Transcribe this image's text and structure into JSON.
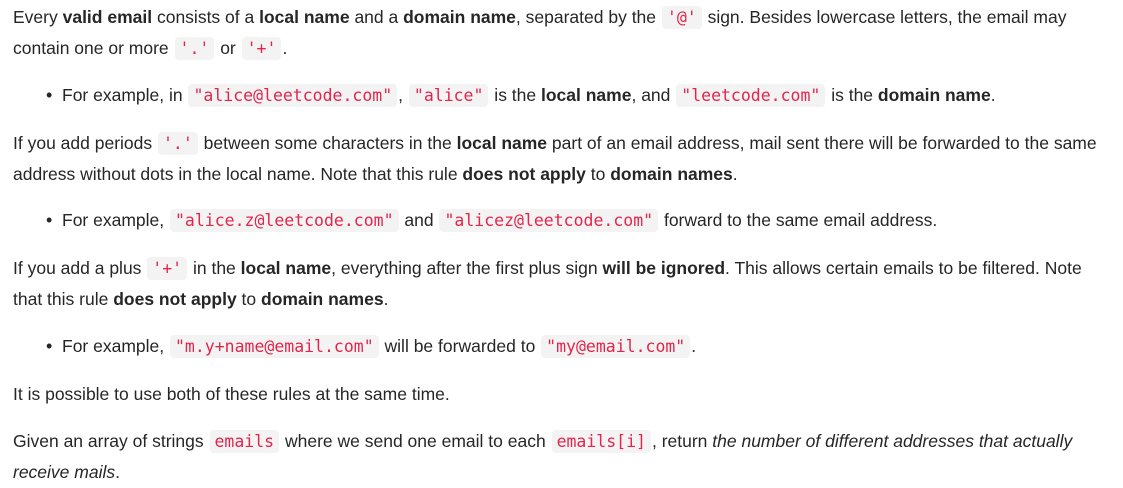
{
  "p1": {
    "t1": "Every ",
    "b1": "valid email",
    "t2": " consists of a ",
    "b2": "local name",
    "t3": " and a ",
    "b3": "domain name",
    "t4": ", separated by the ",
    "c1": "'@'",
    "t5": " sign. Besides lowercase letters, the email may contain one or more ",
    "c2": "'.'",
    "t6": " or ",
    "c3": "'+'",
    "t7": "."
  },
  "b1": {
    "t1": "For example, in ",
    "c1": "\"alice@leetcode.com\"",
    "t2": ", ",
    "c2": "\"alice\"",
    "t3": " is the ",
    "b1": "local name",
    "t4": ", and ",
    "c3": "\"leetcode.com\"",
    "t5": " is the ",
    "b2": "domain name",
    "t6": "."
  },
  "p2": {
    "t1": "If you add periods ",
    "c1": "'.'",
    "t2": " between some characters in the ",
    "b1": "local name",
    "t3": " part of an email address, mail sent there will be forwarded to the same address without dots in the local name. Note that this rule ",
    "b2": "does not apply",
    "t4": " to ",
    "b3": "domain names",
    "t5": "."
  },
  "b2": {
    "t1": "For example, ",
    "c1": "\"alice.z@leetcode.com\"",
    "t2": " and ",
    "c2": "\"alicez@leetcode.com\"",
    "t3": " forward to the same email address."
  },
  "p3": {
    "t1": "If you add a plus ",
    "c1": "'+'",
    "t2": " in the ",
    "b1": "local name",
    "t3": ", everything after the first plus sign ",
    "b2": "will be ignored",
    "t4": ". This allows certain emails to be filtered. Note that this rule ",
    "b3": "does not apply",
    "t5": " to ",
    "b4": "domain names",
    "t6": "."
  },
  "b3": {
    "t1": "For example, ",
    "c1": "\"m.y+name@email.com\"",
    "t2": " will be forwarded to ",
    "c2": "\"my@email.com\"",
    "t3": "."
  },
  "p4": {
    "t1": "It is possible to use both of these rules at the same time."
  },
  "p5": {
    "t1": "Given an array of strings ",
    "c1": "emails",
    "t2": " where we send one email to each ",
    "c2": "emails[i]",
    "t3": ", return ",
    "i1": "the number of different addresses that actually receive mails",
    "t4": "."
  },
  "bullet_glyph": "•"
}
